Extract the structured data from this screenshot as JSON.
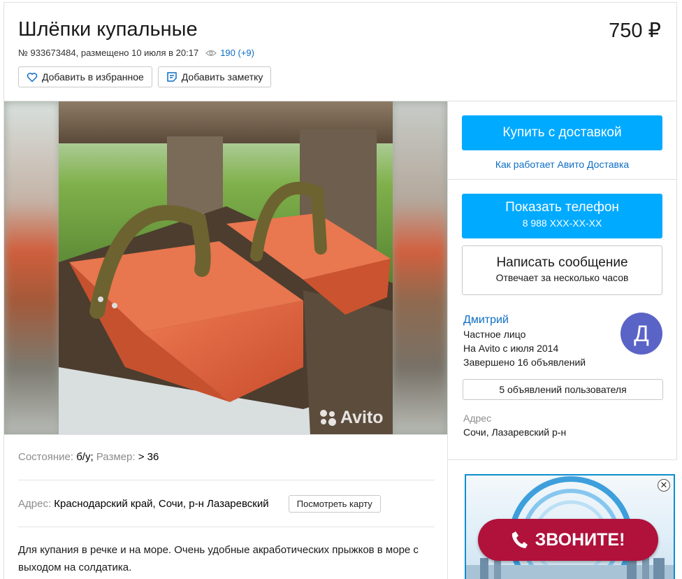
{
  "listing": {
    "title": "Шлёпки купальные",
    "price": "750 ₽",
    "meta": "№ 933673484, размещено 10 июля в 20:17",
    "views": "190 (+9)"
  },
  "actions": {
    "favorite_label": "Добавить в избранное",
    "note_label": "Добавить заметку"
  },
  "photo": {
    "watermark": "Avito"
  },
  "params": {
    "condition_label": "Состояние:",
    "condition_value": "б/у;",
    "size_label": "Размер:",
    "size_value": "> 36"
  },
  "address": {
    "label": "Адрес:",
    "value": "Краснодарский край, Сочи, р-н Лазаревский",
    "map_button": "Посмотреть карту"
  },
  "description": "Для купания в речке и на море. Очень удобные акработических прыжков в море с выходом на солдатика.",
  "sidebar": {
    "buy_button": "Купить с доставкой",
    "delivery_link": "Как работает Авито Доставка",
    "phone_button_title": "Показать телефон",
    "phone_button_number": "8 988 XXX-XX-XX",
    "message_button_title": "Написать сообщение",
    "message_button_sub": "Отвечает за несколько часов",
    "seller": {
      "name": "Дмитрий",
      "type": "Частное лицо",
      "since": "На Avito с июля 2014",
      "completed": "Завершено 16 объявлений",
      "avatar_letter": "Д"
    },
    "user_ads_button": "5 объявлений пользователя",
    "address_label": "Адрес",
    "address_value": "Сочи, Лазаревский р-н"
  },
  "banner": {
    "call_text": "ЗВОНИТЕ!",
    "close": "✕"
  },
  "colors": {
    "accent": "#00aaff",
    "link": "#0d6ec4",
    "avatar": "#5a63c6",
    "banner_pill": "#b0123b"
  }
}
